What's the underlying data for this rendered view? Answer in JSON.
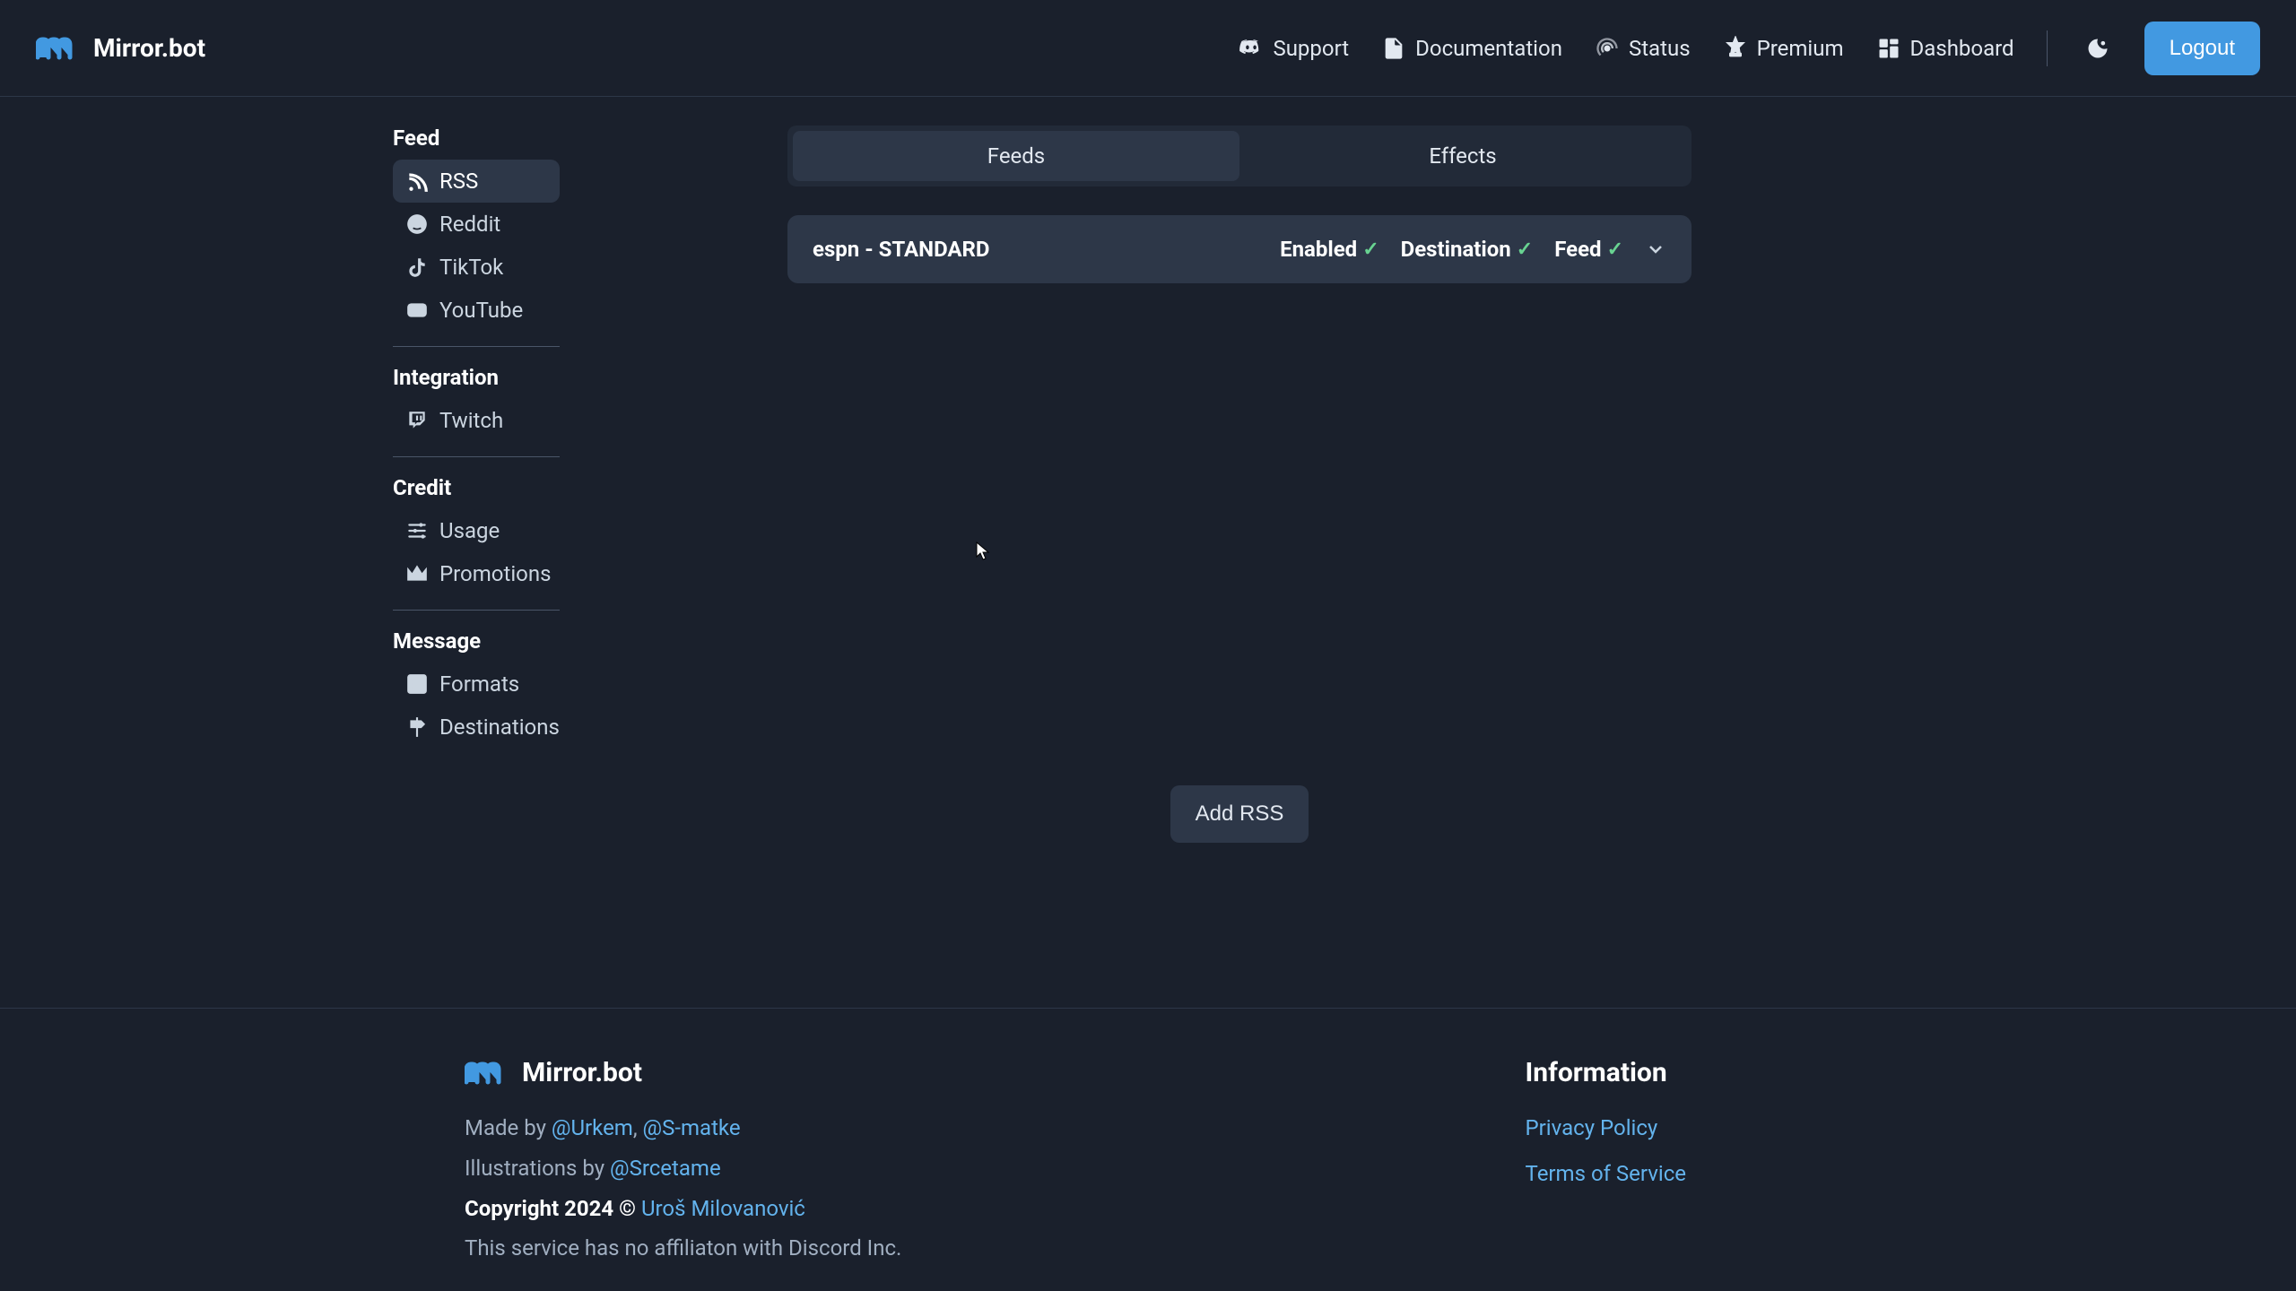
{
  "brand": {
    "name": "Mirror.bot"
  },
  "header": {
    "links": {
      "support": "Support",
      "documentation": "Documentation",
      "status": "Status",
      "premium": "Premium",
      "dashboard": "Dashboard"
    },
    "logout": "Logout"
  },
  "sidebar": {
    "feed": {
      "title": "Feed",
      "items": {
        "rss": "RSS",
        "reddit": "Reddit",
        "tiktok": "TikTok",
        "youtube": "YouTube"
      }
    },
    "integration": {
      "title": "Integration",
      "items": {
        "twitch": "Twitch"
      }
    },
    "credit": {
      "title": "Credit",
      "items": {
        "usage": "Usage",
        "promotions": "Promotions"
      }
    },
    "message": {
      "title": "Message",
      "items": {
        "formats": "Formats",
        "destinations": "Destinations"
      }
    }
  },
  "tabs": {
    "feeds": "Feeds",
    "effects": "Effects"
  },
  "feed_card": {
    "title": "espn - STANDARD",
    "statuses": {
      "enabled": "Enabled",
      "destination": "Destination",
      "feed": "Feed"
    },
    "check": "✓"
  },
  "add_button": "Add RSS",
  "footer": {
    "made_by_prefix": "Made by ",
    "author1": "@Urkem",
    "sep": ", ",
    "author2": "@S-matke",
    "illustrations_prefix": "Illustrations by ",
    "illustrator": "@Srcetame",
    "copyright_prefix": "Copyright 2024 © ",
    "copyright_name": "Uroš Milovanović",
    "disclaimer": "This service has no affiliaton with Discord Inc.",
    "info_heading": "Information",
    "privacy": "Privacy Policy",
    "terms": "Terms of Service"
  }
}
